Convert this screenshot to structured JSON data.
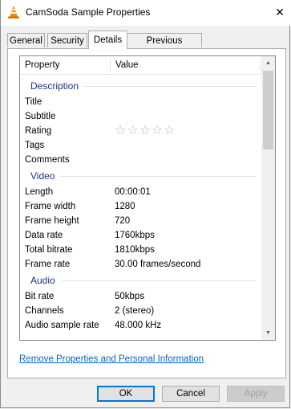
{
  "window": {
    "title": "CamSoda Sample Properties",
    "close_glyph": "✕"
  },
  "tabs": [
    {
      "label": "General"
    },
    {
      "label": "Security"
    },
    {
      "label": "Details",
      "active": true
    },
    {
      "label": "Previous Versions"
    }
  ],
  "list": {
    "columns": {
      "property": "Property",
      "value": "Value"
    },
    "groups": {
      "description": {
        "name": "Description",
        "rows": [
          {
            "property": "Title",
            "value": ""
          },
          {
            "property": "Subtitle",
            "value": ""
          },
          {
            "property": "Rating",
            "value": "",
            "rating": 0,
            "rating_max": 5
          },
          {
            "property": "Tags",
            "value": ""
          },
          {
            "property": "Comments",
            "value": ""
          }
        ]
      },
      "video": {
        "name": "Video",
        "rows": [
          {
            "property": "Length",
            "value": "00:00:01"
          },
          {
            "property": "Frame width",
            "value": "1280"
          },
          {
            "property": "Frame height",
            "value": "720"
          },
          {
            "property": "Data rate",
            "value": "1760kbps"
          },
          {
            "property": "Total bitrate",
            "value": "1810kbps"
          },
          {
            "property": "Frame rate",
            "value": "30.00 frames/second"
          }
        ]
      },
      "audio": {
        "name": "Audio",
        "rows": [
          {
            "property": "Bit rate",
            "value": "50kbps"
          },
          {
            "property": "Channels",
            "value": "2 (stereo)"
          },
          {
            "property": "Audio sample rate",
            "value": "48.000 kHz"
          }
        ]
      }
    }
  },
  "links": {
    "remove": "Remove Properties and Personal Information"
  },
  "buttons": {
    "ok": "OK",
    "cancel": "Cancel",
    "apply": "Apply"
  },
  "colors": {
    "group_heading": "#1e3287",
    "link": "#0066cc",
    "accent": "#0078d7"
  }
}
